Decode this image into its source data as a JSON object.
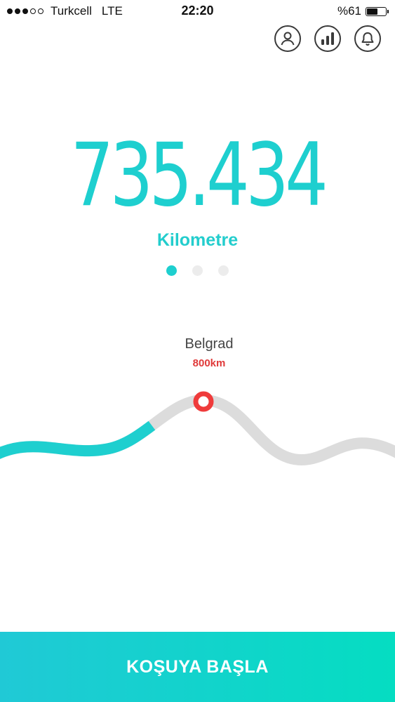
{
  "status_bar": {
    "carrier": "Turkcell",
    "network": "LTE",
    "time": "22:20",
    "battery_text": "%61",
    "battery_level": 0.61,
    "signal_bars_filled": 3,
    "signal_bars_total": 5
  },
  "header": {
    "icons": [
      "profile-icon",
      "stats-icon",
      "notification-bell-icon"
    ]
  },
  "stats": {
    "value": "735.434",
    "unit": "Kilometre",
    "page_indicator": {
      "count": 3,
      "active": 0
    }
  },
  "milestone": {
    "city": "Belgrad",
    "distance": "800km",
    "progress": 0.37
  },
  "colors": {
    "accent": "#1ecfcf",
    "marker": "#ef3b3b",
    "route_remaining": "#dcdcdc",
    "button_gradient_start": "#20c9d6",
    "button_gradient_end": "#05ddc2"
  },
  "footer": {
    "start_button_label": "KOŞUYA BAŞLA"
  }
}
